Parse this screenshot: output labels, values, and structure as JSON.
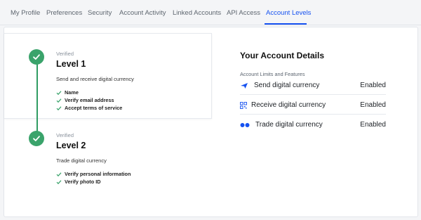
{
  "tabs": [
    {
      "label": "My Profile"
    },
    {
      "label": "Preferences"
    },
    {
      "label": "Security"
    },
    {
      "label": "Account Activity"
    },
    {
      "label": "Linked Accounts"
    },
    {
      "label": "API Access"
    },
    {
      "label": "Account Levels"
    }
  ],
  "active_tab": "Account Levels",
  "accent_color": "#1652f0",
  "success_color": "#3aa36b",
  "levels": [
    {
      "status": "Verified",
      "title": "Level 1",
      "description": "Send and receive digital currency",
      "requirements": [
        "Name",
        "Verify email address",
        "Accept terms of service"
      ]
    },
    {
      "status": "Verified",
      "title": "Level 2",
      "description": "Trade digital currency",
      "requirements": [
        "Verify personal information",
        "Verify photo ID"
      ]
    }
  ],
  "details": {
    "title": "Your Account Details",
    "subtitle": "Account Limits and Features",
    "features": [
      {
        "icon": "send-icon",
        "label": "Send digital currency",
        "status": "Enabled"
      },
      {
        "icon": "qr-code-icon",
        "label": "Receive digital currency",
        "status": "Enabled"
      },
      {
        "icon": "trade-icon",
        "label": "Trade digital currency",
        "status": "Enabled"
      }
    ]
  }
}
